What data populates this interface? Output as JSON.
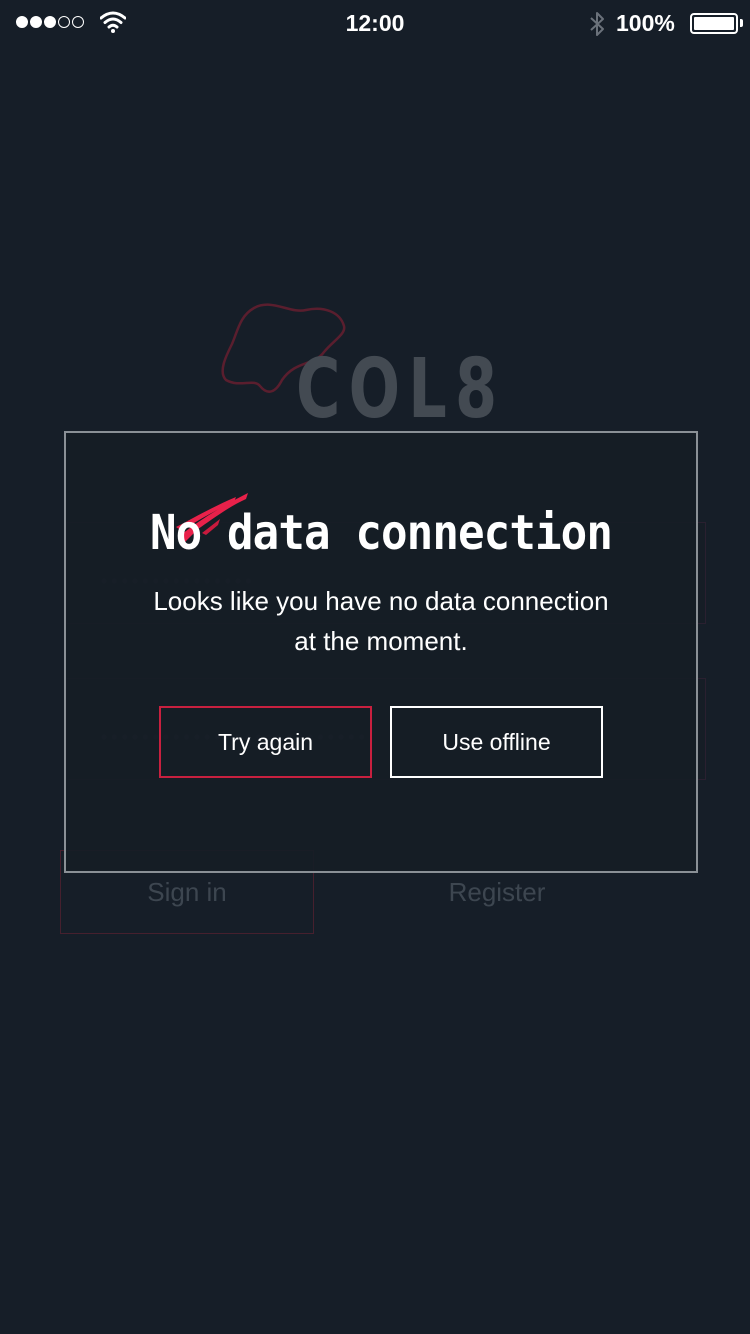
{
  "status_bar": {
    "time": "12:00",
    "battery": "100%",
    "signal_icon": "signal-dots-icon",
    "wifi_icon": "wifi-icon",
    "bluetooth_icon": "bluetooth-icon",
    "battery_icon": "battery-icon"
  },
  "background": {
    "logo_text": "COL8",
    "sign_in_label": "Sign in",
    "register_label": "Register"
  },
  "dialog": {
    "title": "No data connection",
    "message_line1": "Looks like you have no data connection",
    "message_line2": "at the moment.",
    "try_again_label": "Try again",
    "use_offline_label": "Use offline"
  },
  "colors": {
    "background": "#161e28",
    "accent": "#e8214a",
    "dialog_border": "#8a9096",
    "text": "#ffffff"
  }
}
